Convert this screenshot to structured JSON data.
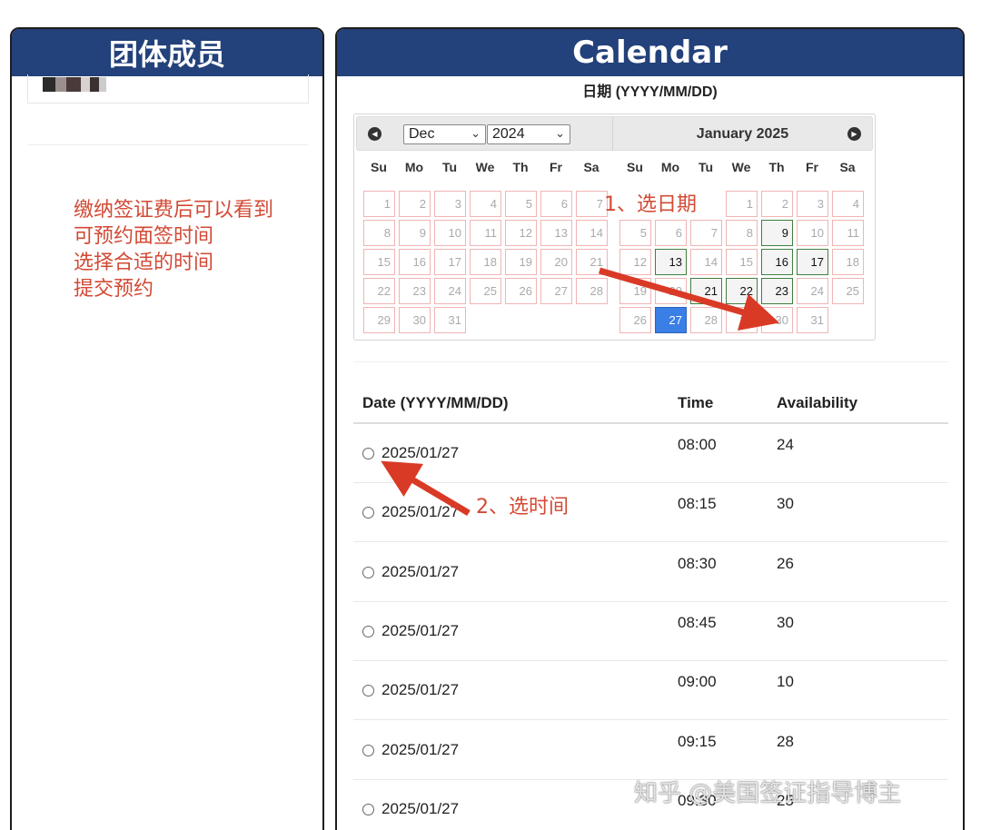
{
  "left_panel": {
    "title": "团体成员",
    "notice": "缴纳签证费后可以看到\n可预约面签时间\n选择合适的时间\n提交预约"
  },
  "right_panel": {
    "title": "Calendar",
    "date_label": "日期 (YYYY/MM/DD)",
    "calendar": {
      "month_select": "Dec",
      "year_select": "2024",
      "next_month_title": "January 2025",
      "weekdays": [
        "Su",
        "Mo",
        "Tu",
        "We",
        "Th",
        "Fr",
        "Sa"
      ],
      "months": [
        {
          "name": "December 2024",
          "first_weekday": 0,
          "days": 31,
          "available": [],
          "selected": null
        },
        {
          "name": "January 2025",
          "first_weekday": 3,
          "days": 31,
          "available": [
            9,
            13,
            16,
            17,
            21,
            22,
            23
          ],
          "selected": 27
        }
      ]
    },
    "table": {
      "headers": {
        "date": "Date (YYYY/MM/DD)",
        "time": "Time",
        "availability": "Availability"
      },
      "rows": [
        {
          "date": "2025/01/27",
          "time": "08:00",
          "availability": "24"
        },
        {
          "date": "2025/01/27",
          "time": "08:15",
          "availability": "30"
        },
        {
          "date": "2025/01/27",
          "time": "08:30",
          "availability": "26"
        },
        {
          "date": "2025/01/27",
          "time": "08:45",
          "availability": "30"
        },
        {
          "date": "2025/01/27",
          "time": "09:00",
          "availability": "10"
        },
        {
          "date": "2025/01/27",
          "time": "09:15",
          "availability": "28"
        },
        {
          "date": "2025/01/27",
          "time": "09:30",
          "availability": "25"
        }
      ]
    }
  },
  "annotations": {
    "step1": "1、选日期",
    "step2": "2、选时间",
    "color": "#d24a35"
  },
  "watermark": "知乎 @美国签证指导博主",
  "colors": {
    "header_bg": "#23417a",
    "selected_day": "#3a7fe6",
    "available_border": "#3f7f3f",
    "unavailable_border": "#f0b4b4"
  }
}
